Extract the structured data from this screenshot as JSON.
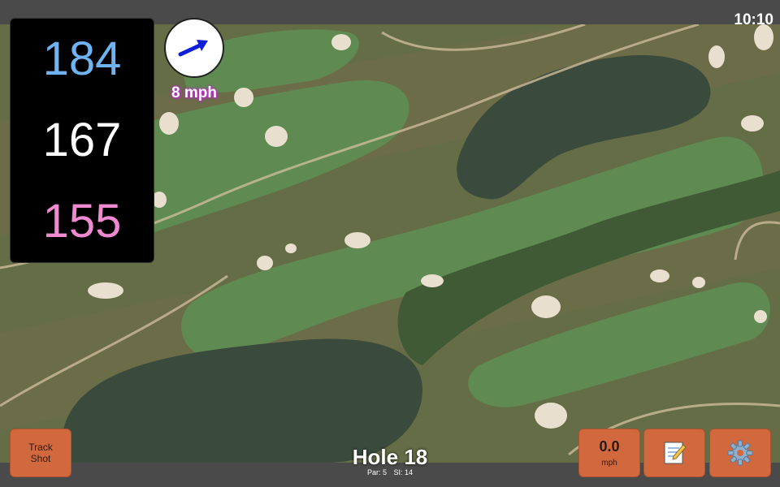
{
  "status": {
    "clock": "10:10"
  },
  "distances": {
    "back": "184",
    "middle": "167",
    "front": "155"
  },
  "wind": {
    "label": "8 mph",
    "icon": "wind-arrow-icon"
  },
  "hole": {
    "title": "Hole 18",
    "par": "Par: 5",
    "si": "SI: 14"
  },
  "buttons": {
    "track_shot_line1": "Track",
    "track_shot_line2": "Shot",
    "speed_value": "0.0",
    "speed_unit": "mph",
    "notes_icon": "memo-icon",
    "settings_icon": "gear-icon"
  },
  "colors": {
    "back_distance": "#6fb3f2",
    "middle_distance": "#ffffff",
    "front_distance": "#f08ad0",
    "button": "#d2693e",
    "wind_arrow": "#1020d8"
  }
}
